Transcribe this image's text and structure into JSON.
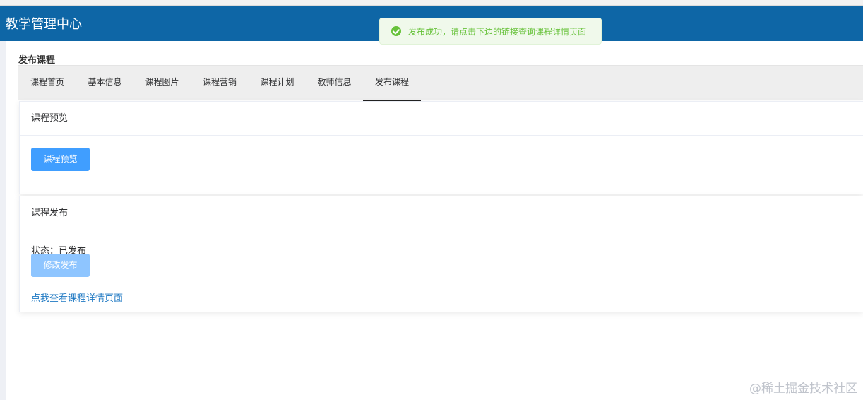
{
  "header": {
    "title": "教学管理中心"
  },
  "toast": {
    "message": "发布成功，请点击下边的链接查询课程详情页面",
    "color": "#67c23a",
    "icon": "check-circle-icon"
  },
  "page": {
    "heading": "发布课程"
  },
  "tabs": [
    {
      "label": "课程首页",
      "active": false
    },
    {
      "label": "基本信息",
      "active": false
    },
    {
      "label": "课程图片",
      "active": false
    },
    {
      "label": "课程营销",
      "active": false
    },
    {
      "label": "课程计划",
      "active": false
    },
    {
      "label": "教师信息",
      "active": false
    },
    {
      "label": "发布课程",
      "active": true
    }
  ],
  "preview_card": {
    "title": "课程预览",
    "button_label": "课程预览"
  },
  "publish_card": {
    "title": "课程发布",
    "status_text": "状态：已发布",
    "button_label": "修改发布",
    "link_text": "点我查看课程详情页面"
  },
  "watermark": "@稀土掘金技术社区",
  "colors": {
    "header_bg": "#0e66a6",
    "primary": "#409eff",
    "link": "#1f79c3"
  }
}
